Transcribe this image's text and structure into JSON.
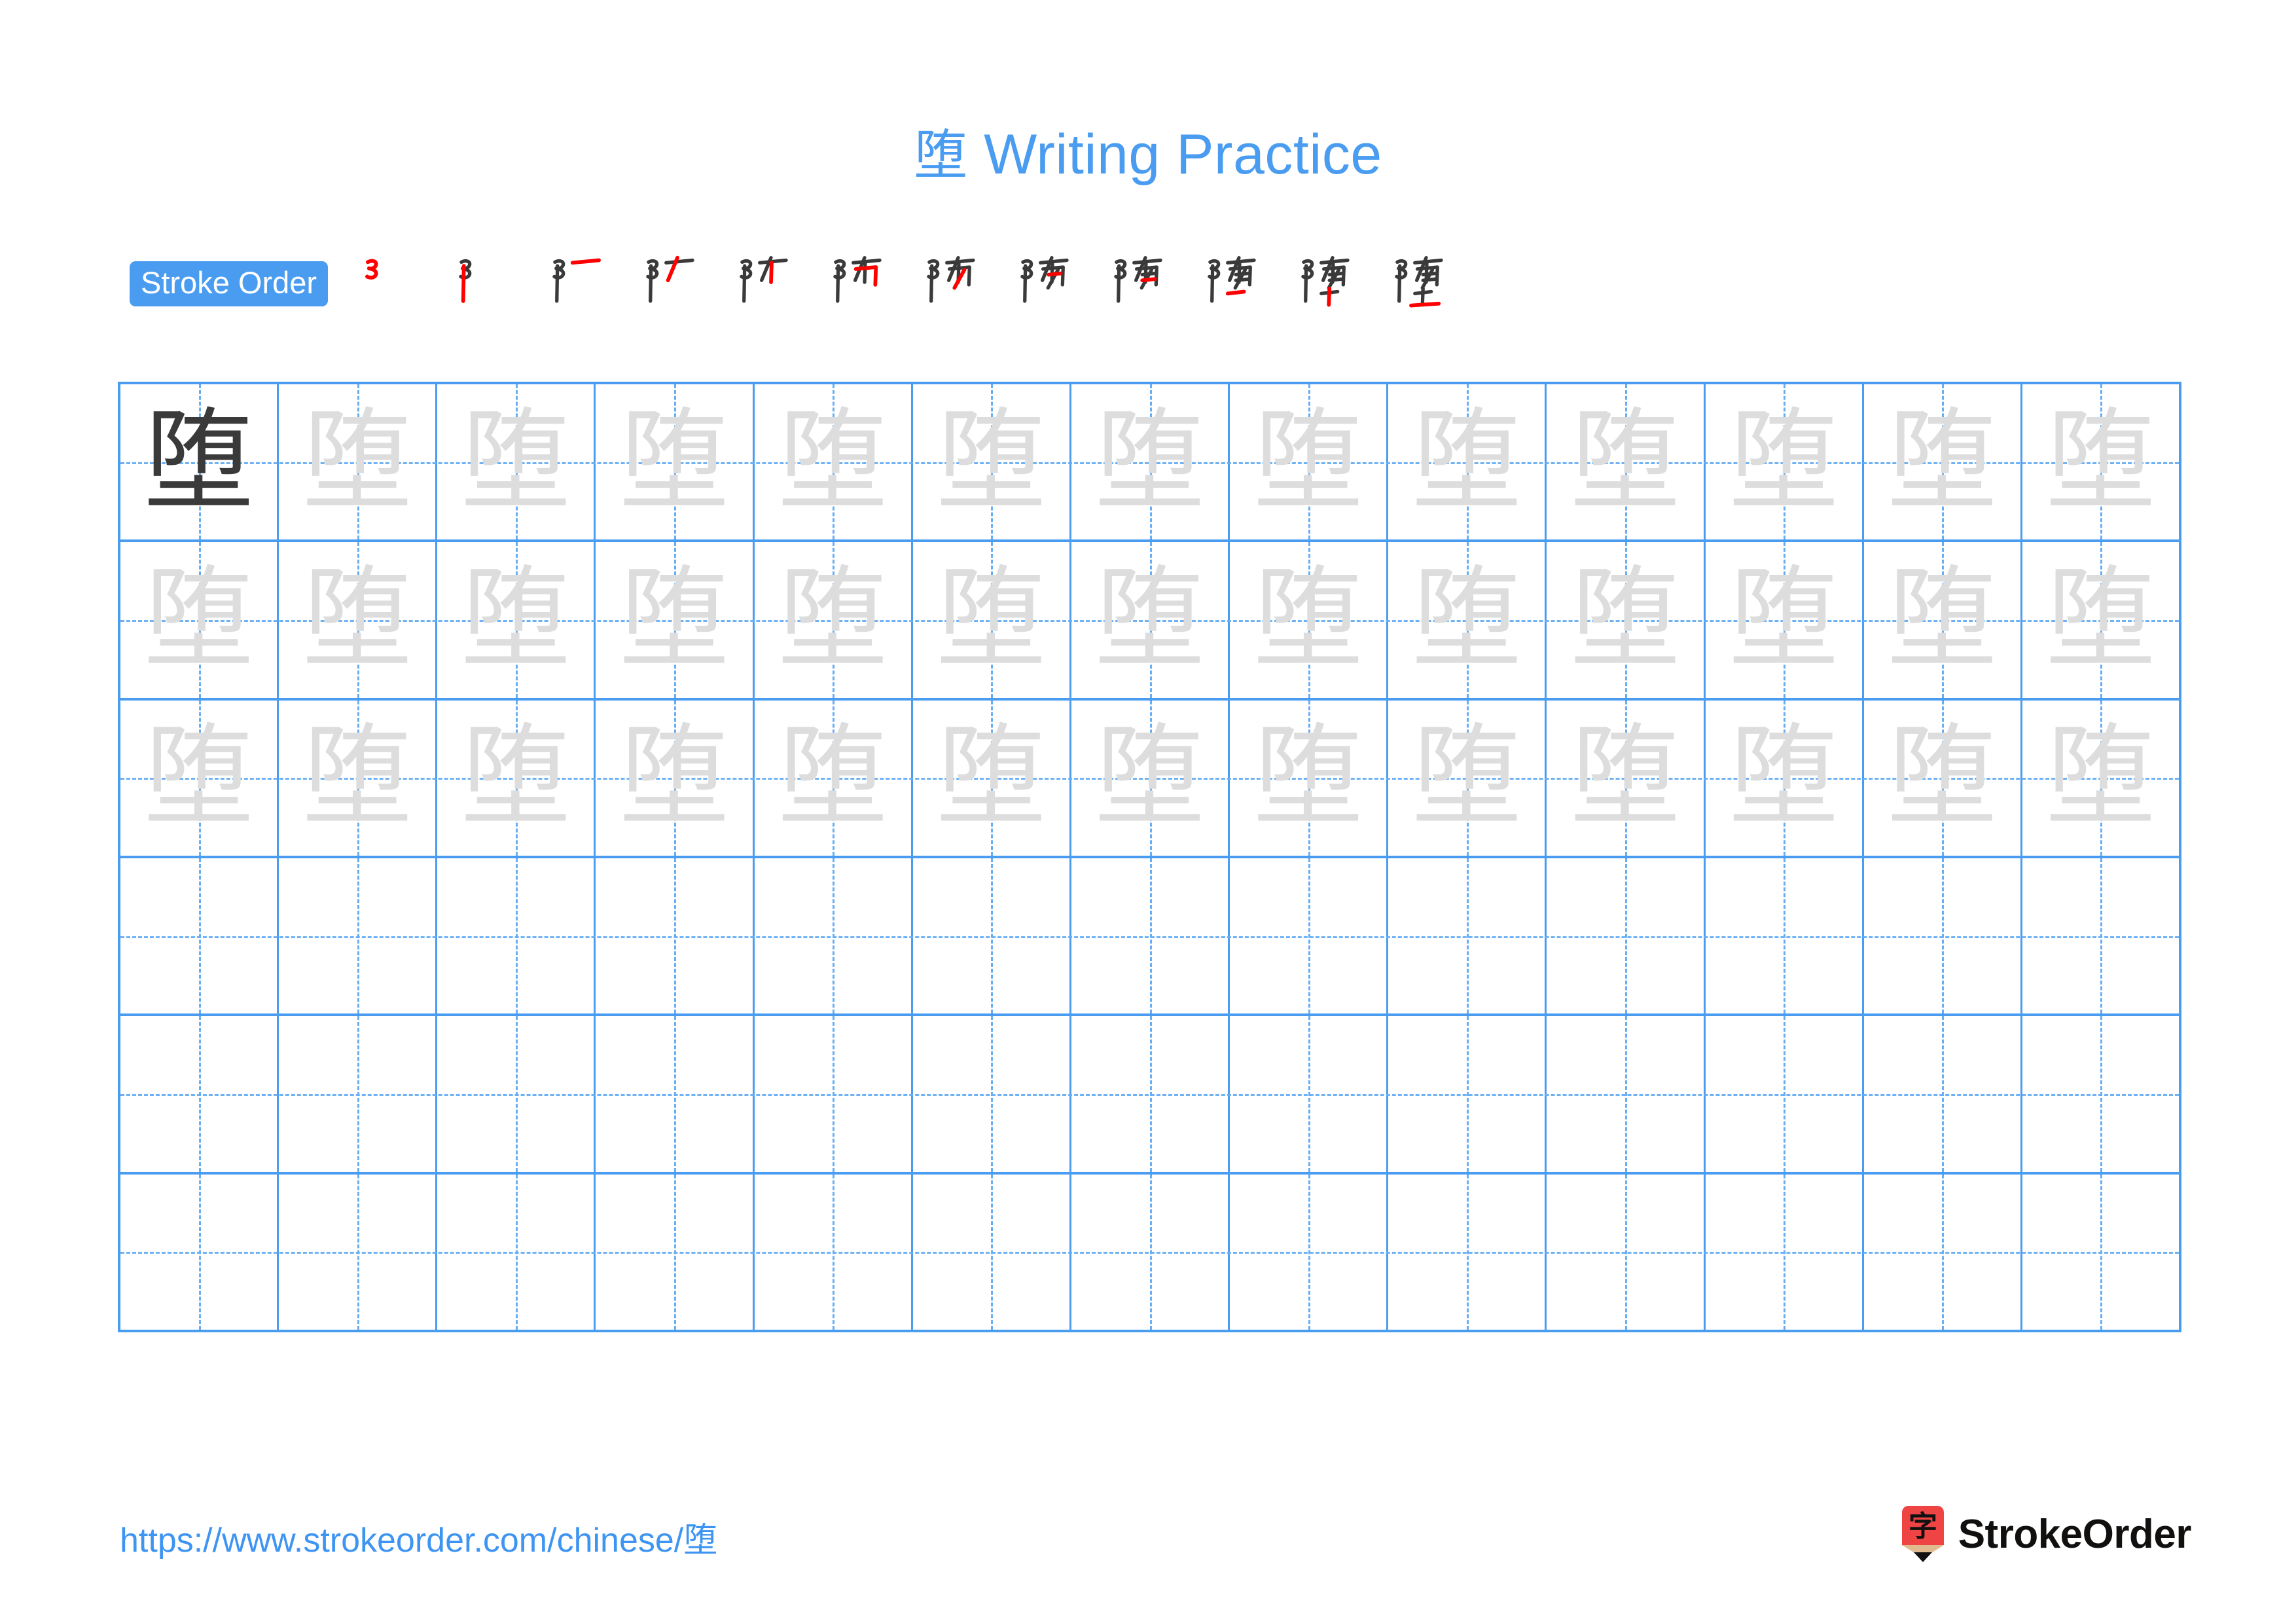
{
  "page": {
    "character": "堕",
    "title_suffix": " Writing Practice",
    "accent_color": "#4a9cf0",
    "grid_line_color": "#4a9cf0",
    "trace_color": "#dddddd",
    "model_color": "#3a3a3a",
    "stroke_highlight_color": "#ff0000",
    "stroke_ink_color": "#3a3a3a"
  },
  "stroke_order": {
    "badge_label": "Stroke Order",
    "total_steps": 12,
    "steps": [
      {
        "index": 1,
        "glyph": "㇀",
        "partial": "々",
        "new_stroke": "heng-pie-wan"
      },
      {
        "index": 2,
        "glyph": "阝",
        "partial": "阝",
        "new_stroke": "shu"
      },
      {
        "index": 3,
        "glyph": "阝一",
        "partial": "阝",
        "new_stroke": "heng"
      },
      {
        "index": 4,
        "glyph": "阝ノ",
        "partial": "阝",
        "new_stroke": "pie"
      },
      {
        "index": 5,
        "glyph": "阝十",
        "partial": "阝",
        "new_stroke": "shu"
      },
      {
        "index": 6,
        "glyph": "防",
        "partial": "防",
        "new_stroke": "heng-zhe-gou"
      },
      {
        "index": 7,
        "glyph": "防",
        "partial": "防",
        "new_stroke": "pie"
      },
      {
        "index": 8,
        "glyph": "随",
        "partial": "随",
        "new_stroke": "heng"
      },
      {
        "index": 9,
        "glyph": "随",
        "partial": "随",
        "new_stroke": "heng"
      },
      {
        "index": 10,
        "glyph": "随",
        "partial": "随",
        "new_stroke": "heng"
      },
      {
        "index": 11,
        "glyph": "堕",
        "partial": "堕",
        "new_stroke": "shu"
      },
      {
        "index": 12,
        "glyph": "堕",
        "partial": "堕",
        "new_stroke": "heng"
      }
    ]
  },
  "practice_grid": {
    "columns": 13,
    "rows": 6,
    "rows_data": [
      {
        "index": 1,
        "cells": [
          {
            "char": "堕",
            "style": "model"
          },
          {
            "char": "堕",
            "style": "trace"
          },
          {
            "char": "堕",
            "style": "trace"
          },
          {
            "char": "堕",
            "style": "trace"
          },
          {
            "char": "堕",
            "style": "trace"
          },
          {
            "char": "堕",
            "style": "trace"
          },
          {
            "char": "堕",
            "style": "trace"
          },
          {
            "char": "堕",
            "style": "trace"
          },
          {
            "char": "堕",
            "style": "trace"
          },
          {
            "char": "堕",
            "style": "trace"
          },
          {
            "char": "堕",
            "style": "trace"
          },
          {
            "char": "堕",
            "style": "trace"
          },
          {
            "char": "堕",
            "style": "trace"
          }
        ]
      },
      {
        "index": 2,
        "cells": [
          {
            "char": "堕",
            "style": "trace"
          },
          {
            "char": "堕",
            "style": "trace"
          },
          {
            "char": "堕",
            "style": "trace"
          },
          {
            "char": "堕",
            "style": "trace"
          },
          {
            "char": "堕",
            "style": "trace"
          },
          {
            "char": "堕",
            "style": "trace"
          },
          {
            "char": "堕",
            "style": "trace"
          },
          {
            "char": "堕",
            "style": "trace"
          },
          {
            "char": "堕",
            "style": "trace"
          },
          {
            "char": "堕",
            "style": "trace"
          },
          {
            "char": "堕",
            "style": "trace"
          },
          {
            "char": "堕",
            "style": "trace"
          },
          {
            "char": "堕",
            "style": "trace"
          }
        ]
      },
      {
        "index": 3,
        "cells": [
          {
            "char": "堕",
            "style": "trace"
          },
          {
            "char": "堕",
            "style": "trace"
          },
          {
            "char": "堕",
            "style": "trace"
          },
          {
            "char": "堕",
            "style": "trace"
          },
          {
            "char": "堕",
            "style": "trace"
          },
          {
            "char": "堕",
            "style": "trace"
          },
          {
            "char": "堕",
            "style": "trace"
          },
          {
            "char": "堕",
            "style": "trace"
          },
          {
            "char": "堕",
            "style": "trace"
          },
          {
            "char": "堕",
            "style": "trace"
          },
          {
            "char": "堕",
            "style": "trace"
          },
          {
            "char": "堕",
            "style": "trace"
          },
          {
            "char": "堕",
            "style": "trace"
          }
        ]
      },
      {
        "index": 4,
        "cells": [
          {
            "char": "",
            "style": "empty"
          },
          {
            "char": "",
            "style": "empty"
          },
          {
            "char": "",
            "style": "empty"
          },
          {
            "char": "",
            "style": "empty"
          },
          {
            "char": "",
            "style": "empty"
          },
          {
            "char": "",
            "style": "empty"
          },
          {
            "char": "",
            "style": "empty"
          },
          {
            "char": "",
            "style": "empty"
          },
          {
            "char": "",
            "style": "empty"
          },
          {
            "char": "",
            "style": "empty"
          },
          {
            "char": "",
            "style": "empty"
          },
          {
            "char": "",
            "style": "empty"
          },
          {
            "char": "",
            "style": "empty"
          }
        ]
      },
      {
        "index": 5,
        "cells": [
          {
            "char": "",
            "style": "empty"
          },
          {
            "char": "",
            "style": "empty"
          },
          {
            "char": "",
            "style": "empty"
          },
          {
            "char": "",
            "style": "empty"
          },
          {
            "char": "",
            "style": "empty"
          },
          {
            "char": "",
            "style": "empty"
          },
          {
            "char": "",
            "style": "empty"
          },
          {
            "char": "",
            "style": "empty"
          },
          {
            "char": "",
            "style": "empty"
          },
          {
            "char": "",
            "style": "empty"
          },
          {
            "char": "",
            "style": "empty"
          },
          {
            "char": "",
            "style": "empty"
          },
          {
            "char": "",
            "style": "empty"
          }
        ]
      },
      {
        "index": 6,
        "cells": [
          {
            "char": "",
            "style": "empty"
          },
          {
            "char": "",
            "style": "empty"
          },
          {
            "char": "",
            "style": "empty"
          },
          {
            "char": "",
            "style": "empty"
          },
          {
            "char": "",
            "style": "empty"
          },
          {
            "char": "",
            "style": "empty"
          },
          {
            "char": "",
            "style": "empty"
          },
          {
            "char": "",
            "style": "empty"
          },
          {
            "char": "",
            "style": "empty"
          },
          {
            "char": "",
            "style": "empty"
          },
          {
            "char": "",
            "style": "empty"
          },
          {
            "char": "",
            "style": "empty"
          },
          {
            "char": "",
            "style": "empty"
          }
        ]
      }
    ]
  },
  "footer": {
    "url": "https://www.strokeorder.com/chinese/堕",
    "brand_name": "StrokeOrder",
    "logo_char": "字",
    "logo_body_color": "#ef4444",
    "logo_wood_color": "#e0bb8f",
    "logo_tip_color": "#111111"
  }
}
